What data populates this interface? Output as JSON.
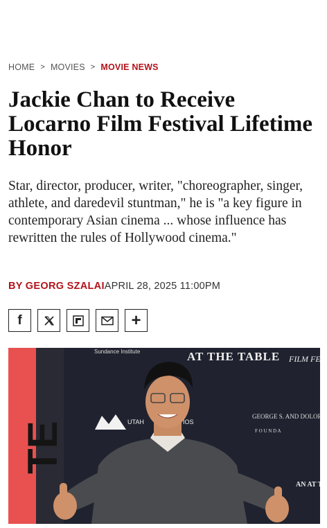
{
  "breadcrumb": {
    "items": [
      "HOME",
      "MOVIES"
    ],
    "current": "MOVIE NEWS",
    "separator": ">"
  },
  "article": {
    "title": "Jackie Chan to Receive Locarno Film Festival Lifetime Honor",
    "dek": "Star, director, producer, writer, \"choreographer, singer, athlete, and daredevil stuntman,\" he is \"a key figure in contemporary Asian cinema ... whose influence has rewritten the rules of Hollywood cinema.\"",
    "author": "BY GEORG SZALAI",
    "date": "APRIL 28, 2025 11:00PM"
  },
  "share": {
    "buttons": [
      {
        "name": "facebook-icon",
        "glyph": "f"
      },
      {
        "name": "x-icon",
        "glyph": "𝕏"
      },
      {
        "name": "flipboard-icon",
        "glyph": ""
      },
      {
        "name": "email-icon",
        "glyph": ""
      },
      {
        "name": "more-icon",
        "glyph": "+"
      }
    ]
  },
  "photo": {
    "backdrop_text": {
      "sundance": "Sundance Institute",
      "at_the_table": "AT THE TABLE",
      "film_fest": "FILM FEST",
      "utah": "UTAH",
      "ios": "IOS",
      "george": "GEORGE S. AND DOLORES",
      "founda": "F O U N D A",
      "att": "AN AT TI"
    }
  },
  "colors": {
    "accent": "#b3131b",
    "text": "#111111"
  }
}
